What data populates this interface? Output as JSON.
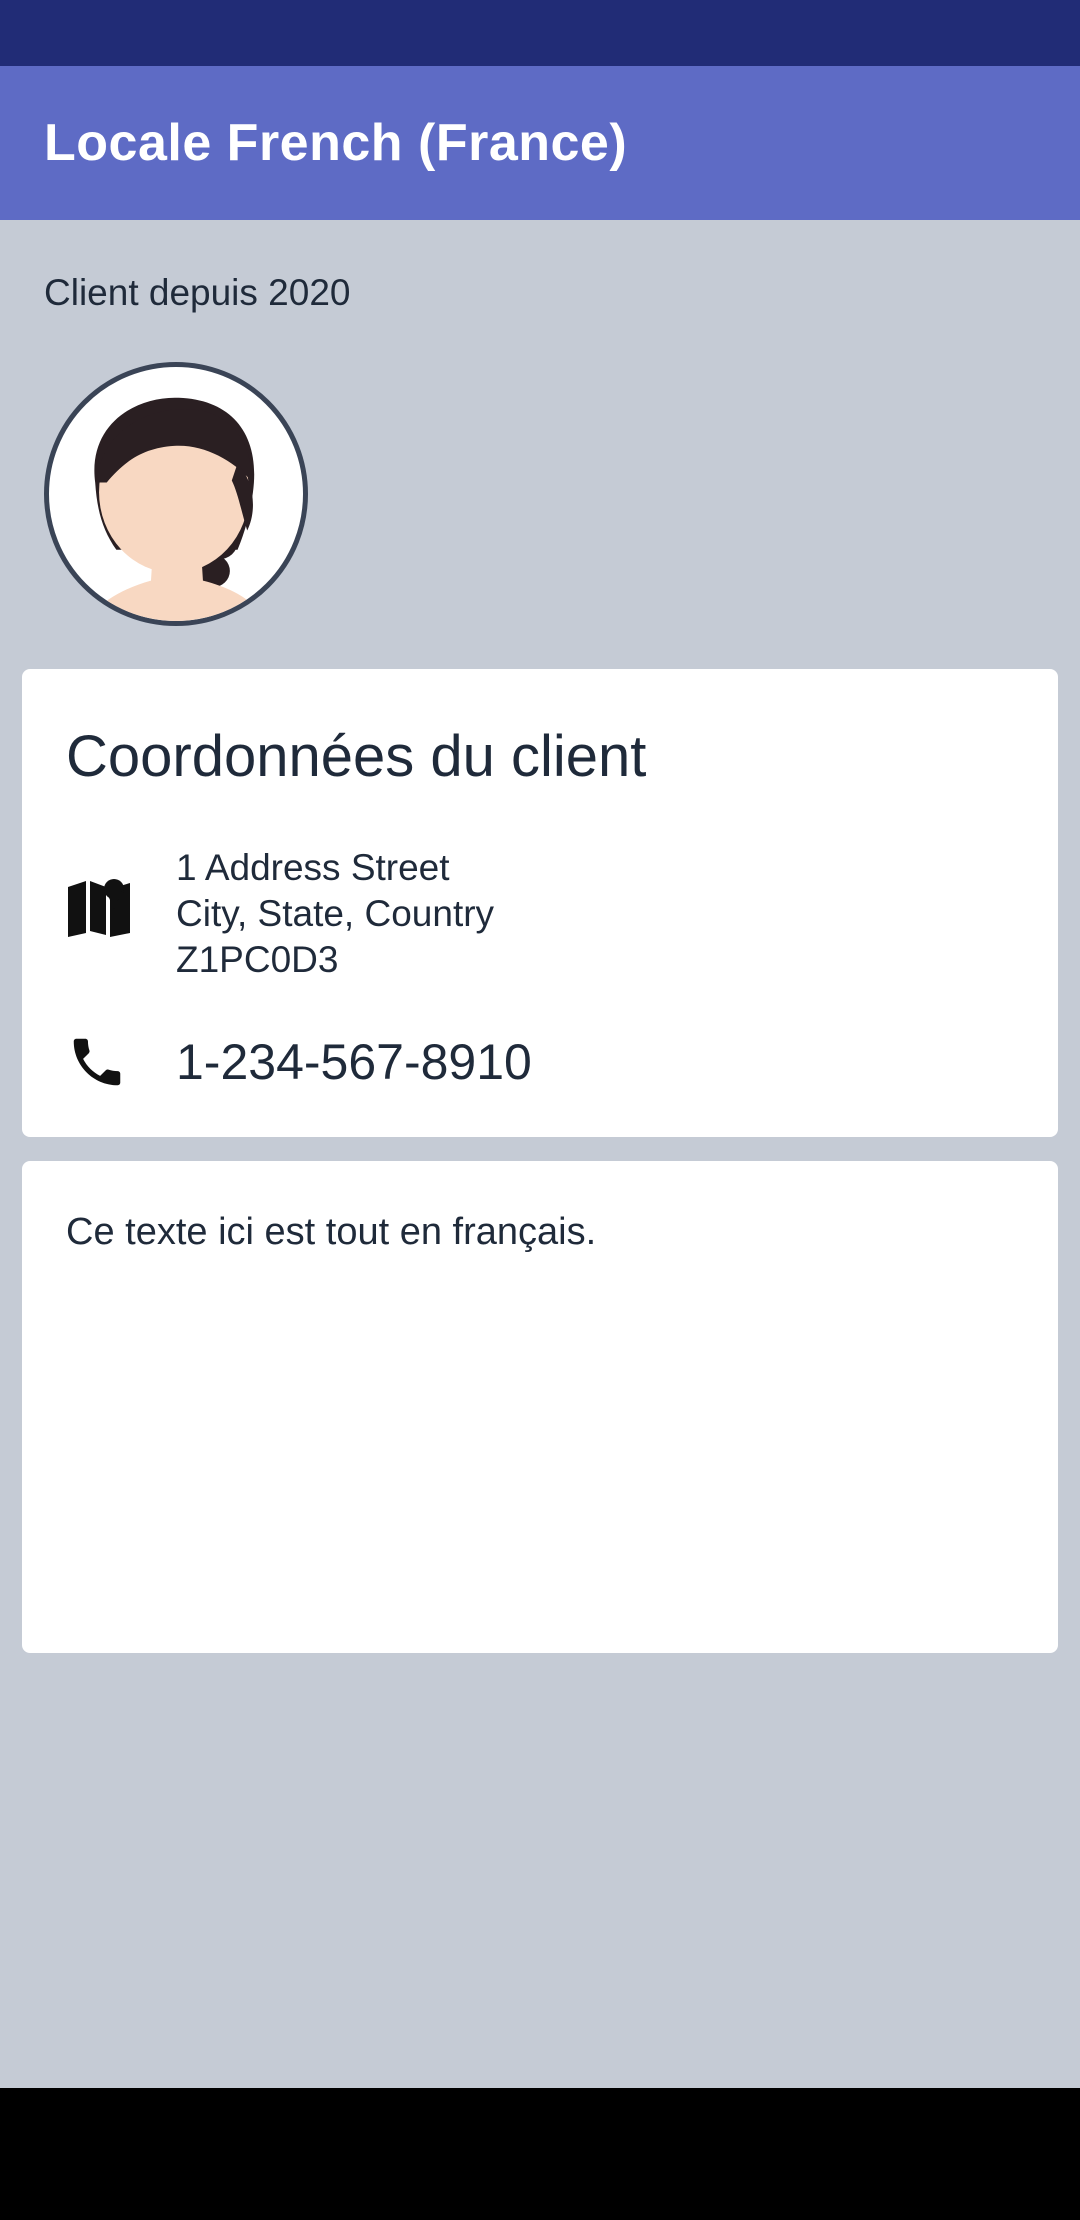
{
  "app_bar": {
    "title": "Locale French (France)"
  },
  "profile": {
    "client_since": "Client depuis 2020",
    "avatar_icon": "woman-avatar-icon"
  },
  "contact_card": {
    "title": "Coordonnées du client",
    "address_icon": "map-icon",
    "address_lines": [
      "1 Address Street",
      "City, State, Country",
      "Z1PC0D3"
    ],
    "phone_icon": "phone-icon",
    "phone": "1-234-567-8910"
  },
  "note_card": {
    "text": "Ce texte ici est tout en français."
  },
  "colors": {
    "status_bar": "#212c76",
    "app_bar": "#5e6bc5",
    "background": "#c5cbd5",
    "card": "#ffffff",
    "text": "#1f2a3a"
  }
}
